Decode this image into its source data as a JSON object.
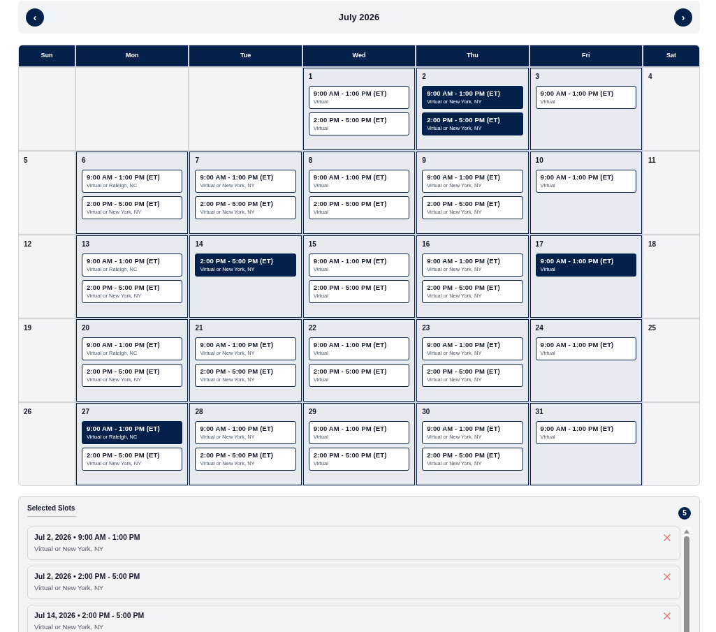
{
  "header": {
    "prev_button": "‹",
    "title": "July 2026",
    "next_button": "›"
  },
  "calendar": {
    "weekdays": [
      "Sun",
      "Mon",
      "Tue",
      "Wed",
      "Thu",
      "Fri",
      "Sat"
    ],
    "weeks": [
      [
        {
          "available": false
        },
        {
          "available": false
        },
        {
          "available": false
        },
        {
          "day": "1",
          "available": true,
          "slots": [
            {
              "time": "9:00 AM - 1:00 PM (ET)",
              "location": "Virtual",
              "selected": false
            },
            {
              "time": "2:00 PM - 5:00 PM (ET)",
              "location": "Virtual",
              "selected": false
            }
          ]
        },
        {
          "day": "2",
          "available": true,
          "slots": [
            {
              "time": "9:00 AM - 1:00 PM (ET)",
              "location": "Virtual or New York, NY",
              "selected": true
            },
            {
              "time": "2:00 PM - 5:00 PM (ET)",
              "location": "Virtual or New York, NY",
              "selected": true
            }
          ]
        },
        {
          "day": "3",
          "available": true,
          "slots": [
            {
              "time": "9:00 AM - 1:00 PM (ET)",
              "location": "Virtual",
              "selected": false
            }
          ]
        },
        {
          "day": "4",
          "available": false
        }
      ],
      [
        {
          "day": "5",
          "available": false
        },
        {
          "day": "6",
          "available": true,
          "slots": [
            {
              "time": "9:00 AM - 1:00 PM (ET)",
              "location": "Virtual or Raleigh, NC",
              "selected": false
            },
            {
              "time": "2:00 PM - 5:00 PM (ET)",
              "location": "Virtual or New York, NY",
              "selected": false
            }
          ]
        },
        {
          "day": "7",
          "available": true,
          "slots": [
            {
              "time": "9:00 AM - 1:00 PM (ET)",
              "location": "Virtual or New York, NY",
              "selected": false
            },
            {
              "time": "2:00 PM - 5:00 PM (ET)",
              "location": "Virtual or New York, NY",
              "selected": false
            }
          ]
        },
        {
          "day": "8",
          "available": true,
          "slots": [
            {
              "time": "9:00 AM - 1:00 PM (ET)",
              "location": "Virtual",
              "selected": false
            },
            {
              "time": "2:00 PM - 5:00 PM (ET)",
              "location": "Virtual",
              "selected": false
            }
          ]
        },
        {
          "day": "9",
          "available": true,
          "slots": [
            {
              "time": "9:00 AM - 1:00 PM (ET)",
              "location": "Virtual or New York, NY",
              "selected": false
            },
            {
              "time": "2:00 PM - 5:00 PM (ET)",
              "location": "Virtual or New York, NY",
              "selected": false
            }
          ]
        },
        {
          "day": "10",
          "available": true,
          "slots": [
            {
              "time": "9:00 AM - 1:00 PM (ET)",
              "location": "Virtual",
              "selected": false
            }
          ]
        },
        {
          "day": "11",
          "available": false
        }
      ],
      [
        {
          "day": "12",
          "available": false
        },
        {
          "day": "13",
          "available": true,
          "slots": [
            {
              "time": "9:00 AM - 1:00 PM (ET)",
              "location": "Virtual or Raleigh, NC",
              "selected": false
            },
            {
              "time": "2:00 PM - 5:00 PM (ET)",
              "location": "Virtual or New York, NY",
              "selected": false
            }
          ]
        },
        {
          "day": "14",
          "available": true,
          "slots": [
            {
              "time": "2:00 PM - 5:00 PM (ET)",
              "location": "Virtual or New York, NY",
              "selected": true
            }
          ]
        },
        {
          "day": "15",
          "available": true,
          "slots": [
            {
              "time": "9:00 AM - 1:00 PM (ET)",
              "location": "Virtual",
              "selected": false
            },
            {
              "time": "2:00 PM - 5:00 PM (ET)",
              "location": "Virtual",
              "selected": false
            }
          ]
        },
        {
          "day": "16",
          "available": true,
          "slots": [
            {
              "time": "9:00 AM - 1:00 PM (ET)",
              "location": "Virtual or New York, NY",
              "selected": false
            },
            {
              "time": "2:00 PM - 5:00 PM (ET)",
              "location": "Virtual or New York, NY",
              "selected": false
            }
          ]
        },
        {
          "day": "17",
          "available": true,
          "slots": [
            {
              "time": "9:00 AM - 1:00 PM (ET)",
              "location": "Virtual",
              "selected": true
            }
          ]
        },
        {
          "day": "18",
          "available": false
        }
      ],
      [
        {
          "day": "19",
          "available": false
        },
        {
          "day": "20",
          "available": true,
          "slots": [
            {
              "time": "9:00 AM - 1:00 PM (ET)",
              "location": "Virtual or Raleigh, NC",
              "selected": false
            },
            {
              "time": "2:00 PM - 5:00 PM (ET)",
              "location": "Virtual or New York, NY",
              "selected": false
            }
          ]
        },
        {
          "day": "21",
          "available": true,
          "slots": [
            {
              "time": "9:00 AM - 1:00 PM (ET)",
              "location": "Virtual or New York, NY",
              "selected": false
            },
            {
              "time": "2:00 PM - 5:00 PM (ET)",
              "location": "Virtual or New York, NY",
              "selected": false
            }
          ]
        },
        {
          "day": "22",
          "available": true,
          "slots": [
            {
              "time": "9:00 AM - 1:00 PM (ET)",
              "location": "Virtual",
              "selected": false
            },
            {
              "time": "2:00 PM - 5:00 PM (ET)",
              "location": "Virtual",
              "selected": false
            }
          ]
        },
        {
          "day": "23",
          "available": true,
          "slots": [
            {
              "time": "9:00 AM - 1:00 PM (ET)",
              "location": "Virtual or New York, NY",
              "selected": false
            },
            {
              "time": "2:00 PM - 5:00 PM (ET)",
              "location": "Virtual or New York, NY",
              "selected": false
            }
          ]
        },
        {
          "day": "24",
          "available": true,
          "slots": [
            {
              "time": "9:00 AM - 1:00 PM (ET)",
              "location": "Virtual",
              "selected": false
            }
          ]
        },
        {
          "day": "25",
          "available": false
        }
      ],
      [
        {
          "day": "26",
          "available": false
        },
        {
          "day": "27",
          "available": true,
          "slots": [
            {
              "time": "9:00 AM - 1:00 PM (ET)",
              "location": "Virtual or Raleigh, NC",
              "selected": true
            },
            {
              "time": "2:00 PM - 5:00 PM (ET)",
              "location": "Virtual or New York, NY",
              "selected": false
            }
          ]
        },
        {
          "day": "28",
          "available": true,
          "slots": [
            {
              "time": "9:00 AM - 1:00 PM (ET)",
              "location": "Virtual or New York, NY",
              "selected": false
            },
            {
              "time": "2:00 PM - 5:00 PM (ET)",
              "location": "Virtual or New York, NY",
              "selected": false
            }
          ]
        },
        {
          "day": "29",
          "available": true,
          "slots": [
            {
              "time": "9:00 AM - 1:00 PM (ET)",
              "location": "Virtual",
              "selected": false
            },
            {
              "time": "2:00 PM - 5:00 PM (ET)",
              "location": "Virtual",
              "selected": false
            }
          ]
        },
        {
          "day": "30",
          "available": true,
          "slots": [
            {
              "time": "9:00 AM - 1:00 PM (ET)",
              "location": "Virtual or New York, NY",
              "selected": false
            },
            {
              "time": "2:00 PM - 5:00 PM (ET)",
              "location": "Virtual or New York, NY",
              "selected": false
            }
          ]
        },
        {
          "day": "31",
          "available": true,
          "slots": [
            {
              "time": "9:00 AM - 1:00 PM (ET)",
              "location": "Virtual",
              "selected": false
            }
          ]
        },
        {
          "available": false
        }
      ]
    ]
  },
  "selected_slots": {
    "title": "Selected Slots",
    "count": "5",
    "items": [
      {
        "title": "Jul 2, 2026 • 9:00 AM - 1:00 PM",
        "location": "Virtual or New York, NY"
      },
      {
        "title": "Jul 2, 2026 • 2:00 PM - 5:00 PM",
        "location": "Virtual or New York, NY"
      },
      {
        "title": "Jul 14, 2026 • 2:00 PM - 5:00 PM",
        "location": "Virtual or New York, NY"
      }
    ]
  }
}
